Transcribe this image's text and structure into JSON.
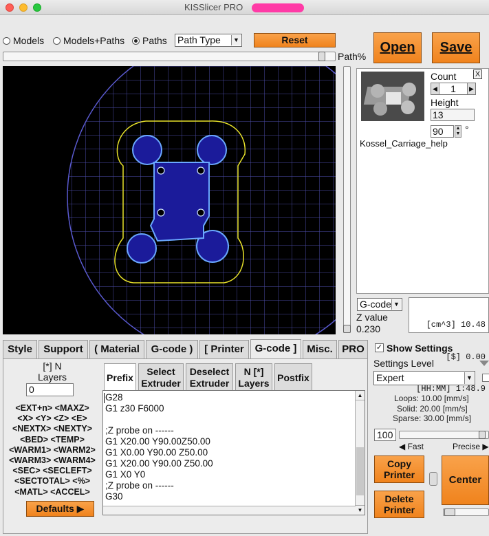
{
  "window": {
    "title": "KISSlicer PRO",
    "lights": {
      "close": "#ff5f57",
      "minimize": "#febc2e",
      "zoom": "#28c840"
    }
  },
  "view_mode": {
    "options": [
      "Models",
      "Models+Paths",
      "Paths"
    ],
    "selected": "Paths",
    "path_type": "Path Type",
    "reset_label": "Reset"
  },
  "path_slider": {
    "label": "Path%",
    "fraction": 0.97
  },
  "actions": {
    "open_label": "Open",
    "save_label": "Save"
  },
  "model": {
    "count_label": "Count",
    "count_value": "1",
    "height_label": "Height",
    "height_value": "13",
    "angle_value": "90",
    "degree": "°",
    "name": "Kossel_Carriage_help",
    "close_label": "X"
  },
  "stats": {
    "mode": "G-code",
    "z_label": "Z value",
    "z_value": "0.230",
    "lines": [
      "[cm^3] 10.48",
      "[$] 0.00",
      "[HH:MM] 1:48.9"
    ]
  },
  "tabs": [
    {
      "label": "Style"
    },
    {
      "label": "Support"
    },
    {
      "label": "( Material"
    },
    {
      "label": "G-code )"
    },
    {
      "label": "[ Printer"
    },
    {
      "label": "G-code ]"
    },
    {
      "label": "Misc."
    },
    {
      "label": "PRO"
    }
  ],
  "active_tab": "G-code ]",
  "gcode": {
    "layers_label_1": "[*] N",
    "layers_label_2": "Layers",
    "layers_value": "0",
    "vars": [
      "<EXT+n> <MAXZ>",
      "<X> <Y> <Z> <E>",
      "<NEXTX> <NEXTY>",
      "<BED> <TEMP>",
      "<WARM1> <WARM2>",
      "<WARM3> <WARM4>",
      "<SEC> <SECLEFT>",
      "<SECTOTAL> <%>",
      "<MATL> <ACCEL>"
    ],
    "defaults_label": "Defaults",
    "subtabs": [
      {
        "l1": "Prefix",
        "l2": ""
      },
      {
        "l1": "Select",
        "l2": "Extruder"
      },
      {
        "l1": "Deselect",
        "l2": "Extruder"
      },
      {
        "l1": "N [*]",
        "l2": "Layers"
      },
      {
        "l1": "Postfix",
        "l2": ""
      }
    ],
    "lines": [
      "G28",
      "G1 z30 F6000",
      "",
      ";Z probe on ------",
      "G1 X20.00 Y90.00Z50.00",
      "G1 X0.00 Y90.00 Z50.00",
      "G1 X20.00 Y90.00 Z50.00",
      "G1 X0 Y0",
      ";Z probe on ------",
      "G30"
    ]
  },
  "settings": {
    "show_label": "Show Settings",
    "level_label": "Settings Level",
    "level_value": "Expert",
    "loops": "Loops:  10.00 [mm/s]",
    "solid": "Solid:  20.00 [mm/s]",
    "sparse": "Sparse:  30.00 [mm/s]",
    "speed_value": "100",
    "speed_fraction": 0.97,
    "fast_label": "Fast",
    "precise_label": "Precise",
    "copy_label_1": "Copy",
    "copy_label_2": "Printer",
    "delete_label_1": "Delete",
    "delete_label_2": "Printer",
    "center_label": "Center"
  }
}
